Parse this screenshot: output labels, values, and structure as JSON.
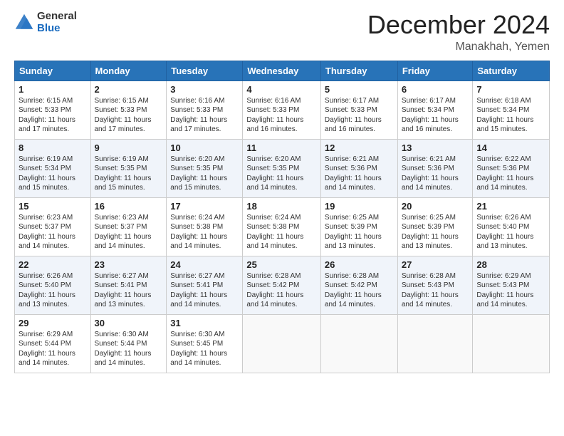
{
  "logo": {
    "general": "General",
    "blue": "Blue"
  },
  "header": {
    "month": "December 2024",
    "location": "Manakhah, Yemen"
  },
  "days_of_week": [
    "Sunday",
    "Monday",
    "Tuesday",
    "Wednesday",
    "Thursday",
    "Friday",
    "Saturday"
  ],
  "weeks": [
    [
      {
        "day": "1",
        "sunrise": "6:15 AM",
        "sunset": "5:33 PM",
        "daylight": "11 hours and 17 minutes."
      },
      {
        "day": "2",
        "sunrise": "6:15 AM",
        "sunset": "5:33 PM",
        "daylight": "11 hours and 17 minutes."
      },
      {
        "day": "3",
        "sunrise": "6:16 AM",
        "sunset": "5:33 PM",
        "daylight": "11 hours and 17 minutes."
      },
      {
        "day": "4",
        "sunrise": "6:16 AM",
        "sunset": "5:33 PM",
        "daylight": "11 hours and 16 minutes."
      },
      {
        "day": "5",
        "sunrise": "6:17 AM",
        "sunset": "5:33 PM",
        "daylight": "11 hours and 16 minutes."
      },
      {
        "day": "6",
        "sunrise": "6:17 AM",
        "sunset": "5:34 PM",
        "daylight": "11 hours and 16 minutes."
      },
      {
        "day": "7",
        "sunrise": "6:18 AM",
        "sunset": "5:34 PM",
        "daylight": "11 hours and 15 minutes."
      }
    ],
    [
      {
        "day": "8",
        "sunrise": "6:19 AM",
        "sunset": "5:34 PM",
        "daylight": "11 hours and 15 minutes."
      },
      {
        "day": "9",
        "sunrise": "6:19 AM",
        "sunset": "5:35 PM",
        "daylight": "11 hours and 15 minutes."
      },
      {
        "day": "10",
        "sunrise": "6:20 AM",
        "sunset": "5:35 PM",
        "daylight": "11 hours and 15 minutes."
      },
      {
        "day": "11",
        "sunrise": "6:20 AM",
        "sunset": "5:35 PM",
        "daylight": "11 hours and 14 minutes."
      },
      {
        "day": "12",
        "sunrise": "6:21 AM",
        "sunset": "5:36 PM",
        "daylight": "11 hours and 14 minutes."
      },
      {
        "day": "13",
        "sunrise": "6:21 AM",
        "sunset": "5:36 PM",
        "daylight": "11 hours and 14 minutes."
      },
      {
        "day": "14",
        "sunrise": "6:22 AM",
        "sunset": "5:36 PM",
        "daylight": "11 hours and 14 minutes."
      }
    ],
    [
      {
        "day": "15",
        "sunrise": "6:23 AM",
        "sunset": "5:37 PM",
        "daylight": "11 hours and 14 minutes."
      },
      {
        "day": "16",
        "sunrise": "6:23 AM",
        "sunset": "5:37 PM",
        "daylight": "11 hours and 14 minutes."
      },
      {
        "day": "17",
        "sunrise": "6:24 AM",
        "sunset": "5:38 PM",
        "daylight": "11 hours and 14 minutes."
      },
      {
        "day": "18",
        "sunrise": "6:24 AM",
        "sunset": "5:38 PM",
        "daylight": "11 hours and 14 minutes."
      },
      {
        "day": "19",
        "sunrise": "6:25 AM",
        "sunset": "5:39 PM",
        "daylight": "11 hours and 13 minutes."
      },
      {
        "day": "20",
        "sunrise": "6:25 AM",
        "sunset": "5:39 PM",
        "daylight": "11 hours and 13 minutes."
      },
      {
        "day": "21",
        "sunrise": "6:26 AM",
        "sunset": "5:40 PM",
        "daylight": "11 hours and 13 minutes."
      }
    ],
    [
      {
        "day": "22",
        "sunrise": "6:26 AM",
        "sunset": "5:40 PM",
        "daylight": "11 hours and 13 minutes."
      },
      {
        "day": "23",
        "sunrise": "6:27 AM",
        "sunset": "5:41 PM",
        "daylight": "11 hours and 13 minutes."
      },
      {
        "day": "24",
        "sunrise": "6:27 AM",
        "sunset": "5:41 PM",
        "daylight": "11 hours and 14 minutes."
      },
      {
        "day": "25",
        "sunrise": "6:28 AM",
        "sunset": "5:42 PM",
        "daylight": "11 hours and 14 minutes."
      },
      {
        "day": "26",
        "sunrise": "6:28 AM",
        "sunset": "5:42 PM",
        "daylight": "11 hours and 14 minutes."
      },
      {
        "day": "27",
        "sunrise": "6:28 AM",
        "sunset": "5:43 PM",
        "daylight": "11 hours and 14 minutes."
      },
      {
        "day": "28",
        "sunrise": "6:29 AM",
        "sunset": "5:43 PM",
        "daylight": "11 hours and 14 minutes."
      }
    ],
    [
      {
        "day": "29",
        "sunrise": "6:29 AM",
        "sunset": "5:44 PM",
        "daylight": "11 hours and 14 minutes."
      },
      {
        "day": "30",
        "sunrise": "6:30 AM",
        "sunset": "5:44 PM",
        "daylight": "11 hours and 14 minutes."
      },
      {
        "day": "31",
        "sunrise": "6:30 AM",
        "sunset": "5:45 PM",
        "daylight": "11 hours and 14 minutes."
      },
      null,
      null,
      null,
      null
    ]
  ],
  "labels": {
    "sunrise": "Sunrise:",
    "sunset": "Sunset:",
    "daylight": "Daylight:"
  }
}
